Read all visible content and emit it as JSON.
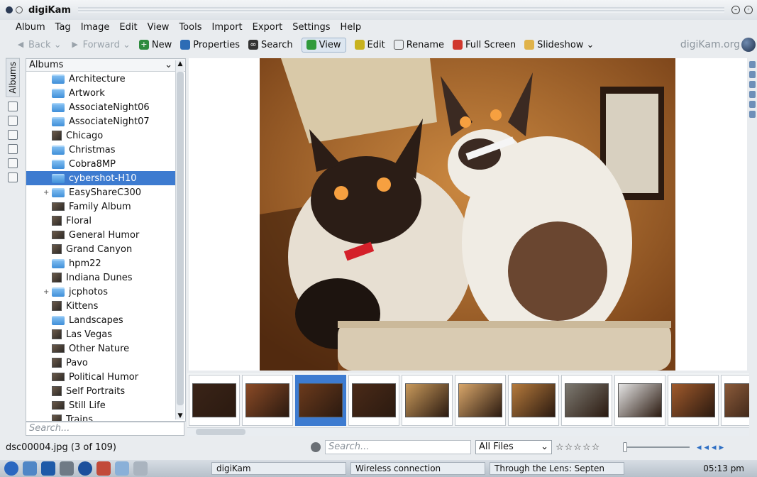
{
  "window": {
    "title": "digiKam"
  },
  "menu": [
    "Album",
    "Tag",
    "Image",
    "Edit",
    "View",
    "Tools",
    "Import",
    "Export",
    "Settings",
    "Help"
  ],
  "toolbar": {
    "back": "Back",
    "forward": "Forward",
    "new": "New",
    "properties": "Properties",
    "search": "Search",
    "view": "View",
    "edit": "Edit",
    "rename": "Rename",
    "fullscreen": "Full Screen",
    "slideshow": "Slideshow",
    "brand": "digiKam.org"
  },
  "left_tabs": {
    "albums": "Albums"
  },
  "albums_panel": {
    "header": "Albums",
    "search_placeholder": "Search...",
    "items": [
      {
        "label": "Architecture",
        "icon": "folder"
      },
      {
        "label": "Artwork",
        "icon": "folder"
      },
      {
        "label": "AssociateNight06",
        "icon": "folder"
      },
      {
        "label": "AssociateNight07",
        "icon": "folder"
      },
      {
        "label": "Chicago",
        "icon": "thumb"
      },
      {
        "label": "Christmas",
        "icon": "folder"
      },
      {
        "label": "Cobra8MP",
        "icon": "folder"
      },
      {
        "label": "cybershot-H10",
        "icon": "folder",
        "selected": true
      },
      {
        "label": "EasyShareC300",
        "icon": "folder",
        "expandable": true
      },
      {
        "label": "Family Album",
        "icon": "thumb"
      },
      {
        "label": "Floral",
        "icon": "thumb"
      },
      {
        "label": "General Humor",
        "icon": "thumb"
      },
      {
        "label": "Grand Canyon",
        "icon": "thumb"
      },
      {
        "label": "hpm22",
        "icon": "folder"
      },
      {
        "label": "Indiana Dunes",
        "icon": "thumb"
      },
      {
        "label": "jcphotos",
        "icon": "folder",
        "expandable": true
      },
      {
        "label": "Kittens",
        "icon": "thumb"
      },
      {
        "label": "Landscapes",
        "icon": "folder"
      },
      {
        "label": "Las Vegas",
        "icon": "thumb"
      },
      {
        "label": "Other Nature",
        "icon": "thumb"
      },
      {
        "label": "Pavo",
        "icon": "thumb"
      },
      {
        "label": "Political Humor",
        "icon": "thumb"
      },
      {
        "label": "Self Portraits",
        "icon": "thumb"
      },
      {
        "label": "Still Life",
        "icon": "thumb"
      },
      {
        "label": "Trains",
        "icon": "thumb"
      }
    ]
  },
  "filmstrip": {
    "count_visible": 11,
    "selected_index": 2
  },
  "statusbar": {
    "filename": "dsc00004.jpg (3 of 109)",
    "search_placeholder": "Search...",
    "filter": "All Files",
    "stars": "☆☆☆☆☆"
  },
  "taskbar": {
    "tasks": [
      "digiKam",
      "Wireless connection",
      "Through the Lens: Septen"
    ],
    "clock": "05:13 pm"
  },
  "colors": {
    "selection": "#3d7bd0",
    "folder": "#5aa6e6"
  }
}
